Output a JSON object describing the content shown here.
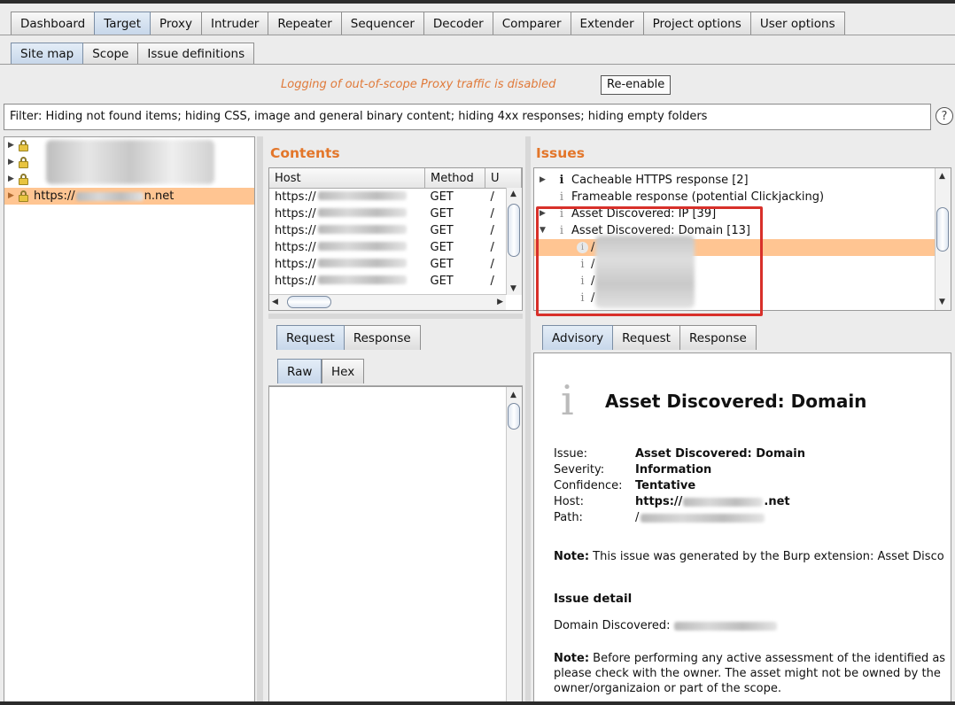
{
  "main_tabs": [
    "Dashboard",
    "Target",
    "Proxy",
    "Intruder",
    "Repeater",
    "Sequencer",
    "Decoder",
    "Comparer",
    "Extender",
    "Project options",
    "User options"
  ],
  "sub_tabs": [
    "Site map",
    "Scope",
    "Issue definitions"
  ],
  "logging": {
    "message": "Logging of out-of-scope Proxy traffic is disabled",
    "button": "Re-enable"
  },
  "filter": {
    "text": "Filter: Hiding not found items;  hiding CSS, image and general binary content;  hiding 4xx responses;  hiding empty folders",
    "help": "?"
  },
  "site_map": {
    "selected_item": "https://",
    "selected_suffix": "n.net"
  },
  "contents": {
    "title": "Contents",
    "columns": [
      "Host",
      "Method",
      "U"
    ],
    "rows": [
      {
        "host": "https://",
        "method": "GET",
        "u": "/"
      },
      {
        "host": "https://",
        "method": "GET",
        "u": "/"
      },
      {
        "host": "https://",
        "method": "GET",
        "u": "/"
      },
      {
        "host": "https://",
        "method": "GET",
        "u": "/"
      },
      {
        "host": "https://",
        "method": "GET",
        "u": "/"
      },
      {
        "host": "https://",
        "method": "GET",
        "u": "/"
      }
    ]
  },
  "issues": {
    "title": "Issues",
    "items": [
      {
        "label": "Cacheable HTTPS response [2]"
      },
      {
        "label": "Frameable response (potential Clickjacking)"
      },
      {
        "label": "Asset Discovered: IP [39]"
      },
      {
        "label": "Asset Discovered: Domain [13]"
      }
    ],
    "children": [
      "/",
      "/",
      "/",
      "/"
    ]
  },
  "request_tabs": [
    "Request",
    "Response"
  ],
  "raw_hex_tabs": [
    "Raw",
    "Hex"
  ],
  "advisory_tabs": [
    "Advisory",
    "Request",
    "Response"
  ],
  "advisory": {
    "title": "Asset Discovered: Domain",
    "fields": [
      {
        "key": "Issue:",
        "value": "Asset Discovered: Domain"
      },
      {
        "key": "Severity:",
        "value": "Information"
      },
      {
        "key": "Confidence:",
        "value": "Tentative"
      },
      {
        "key": "Host:",
        "value": "https://",
        "value_suffix": ".net"
      },
      {
        "key": "Path:",
        "value": "/"
      }
    ],
    "note1_label": "Note:",
    "note1_text": " This issue was generated by the Burp extension: Asset Disco",
    "detail_heading": "Issue detail",
    "domain_label": "Domain Discovered:",
    "note2_label": "Note:",
    "note2_line1": " Before performing any active assessment of the identified as",
    "note2_line2": "please check with the owner. The asset might not be owned by the",
    "note2_line3": "owner/organizaion or part of the scope."
  }
}
